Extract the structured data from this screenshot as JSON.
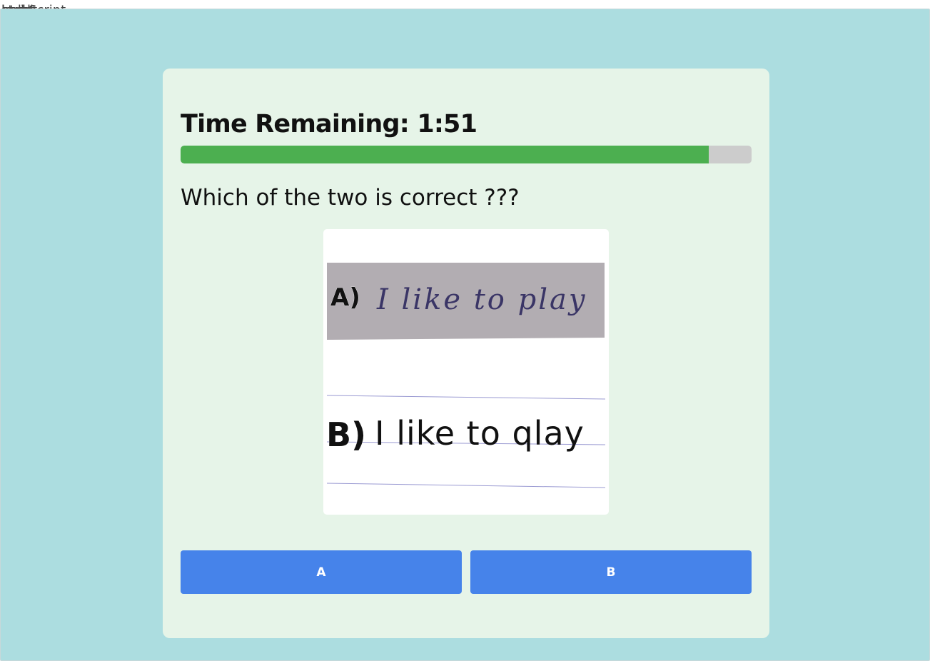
{
  "header_overlap": [
    "index",
    "html",
    "head",
    "script",
    "style",
    "body",
    "JavaScript"
  ],
  "quiz": {
    "timer_label": "Time Remaining:",
    "timer_value": "1:51",
    "progress_fraction": 0.925,
    "question": "Which of the two is correct ???",
    "image": {
      "option_a_label": "A)",
      "option_a_text": "I like to play",
      "option_b_label": "B)",
      "option_b_text": "I like to qlay"
    },
    "answers": {
      "a_label": "A",
      "b_label": "B"
    }
  },
  "colors": {
    "page_bg": "#acdde0",
    "card_bg": "#e6f4e8",
    "progress_fill": "#4caf50",
    "progress_track": "#cccccc",
    "button_bg": "#4683ea"
  }
}
